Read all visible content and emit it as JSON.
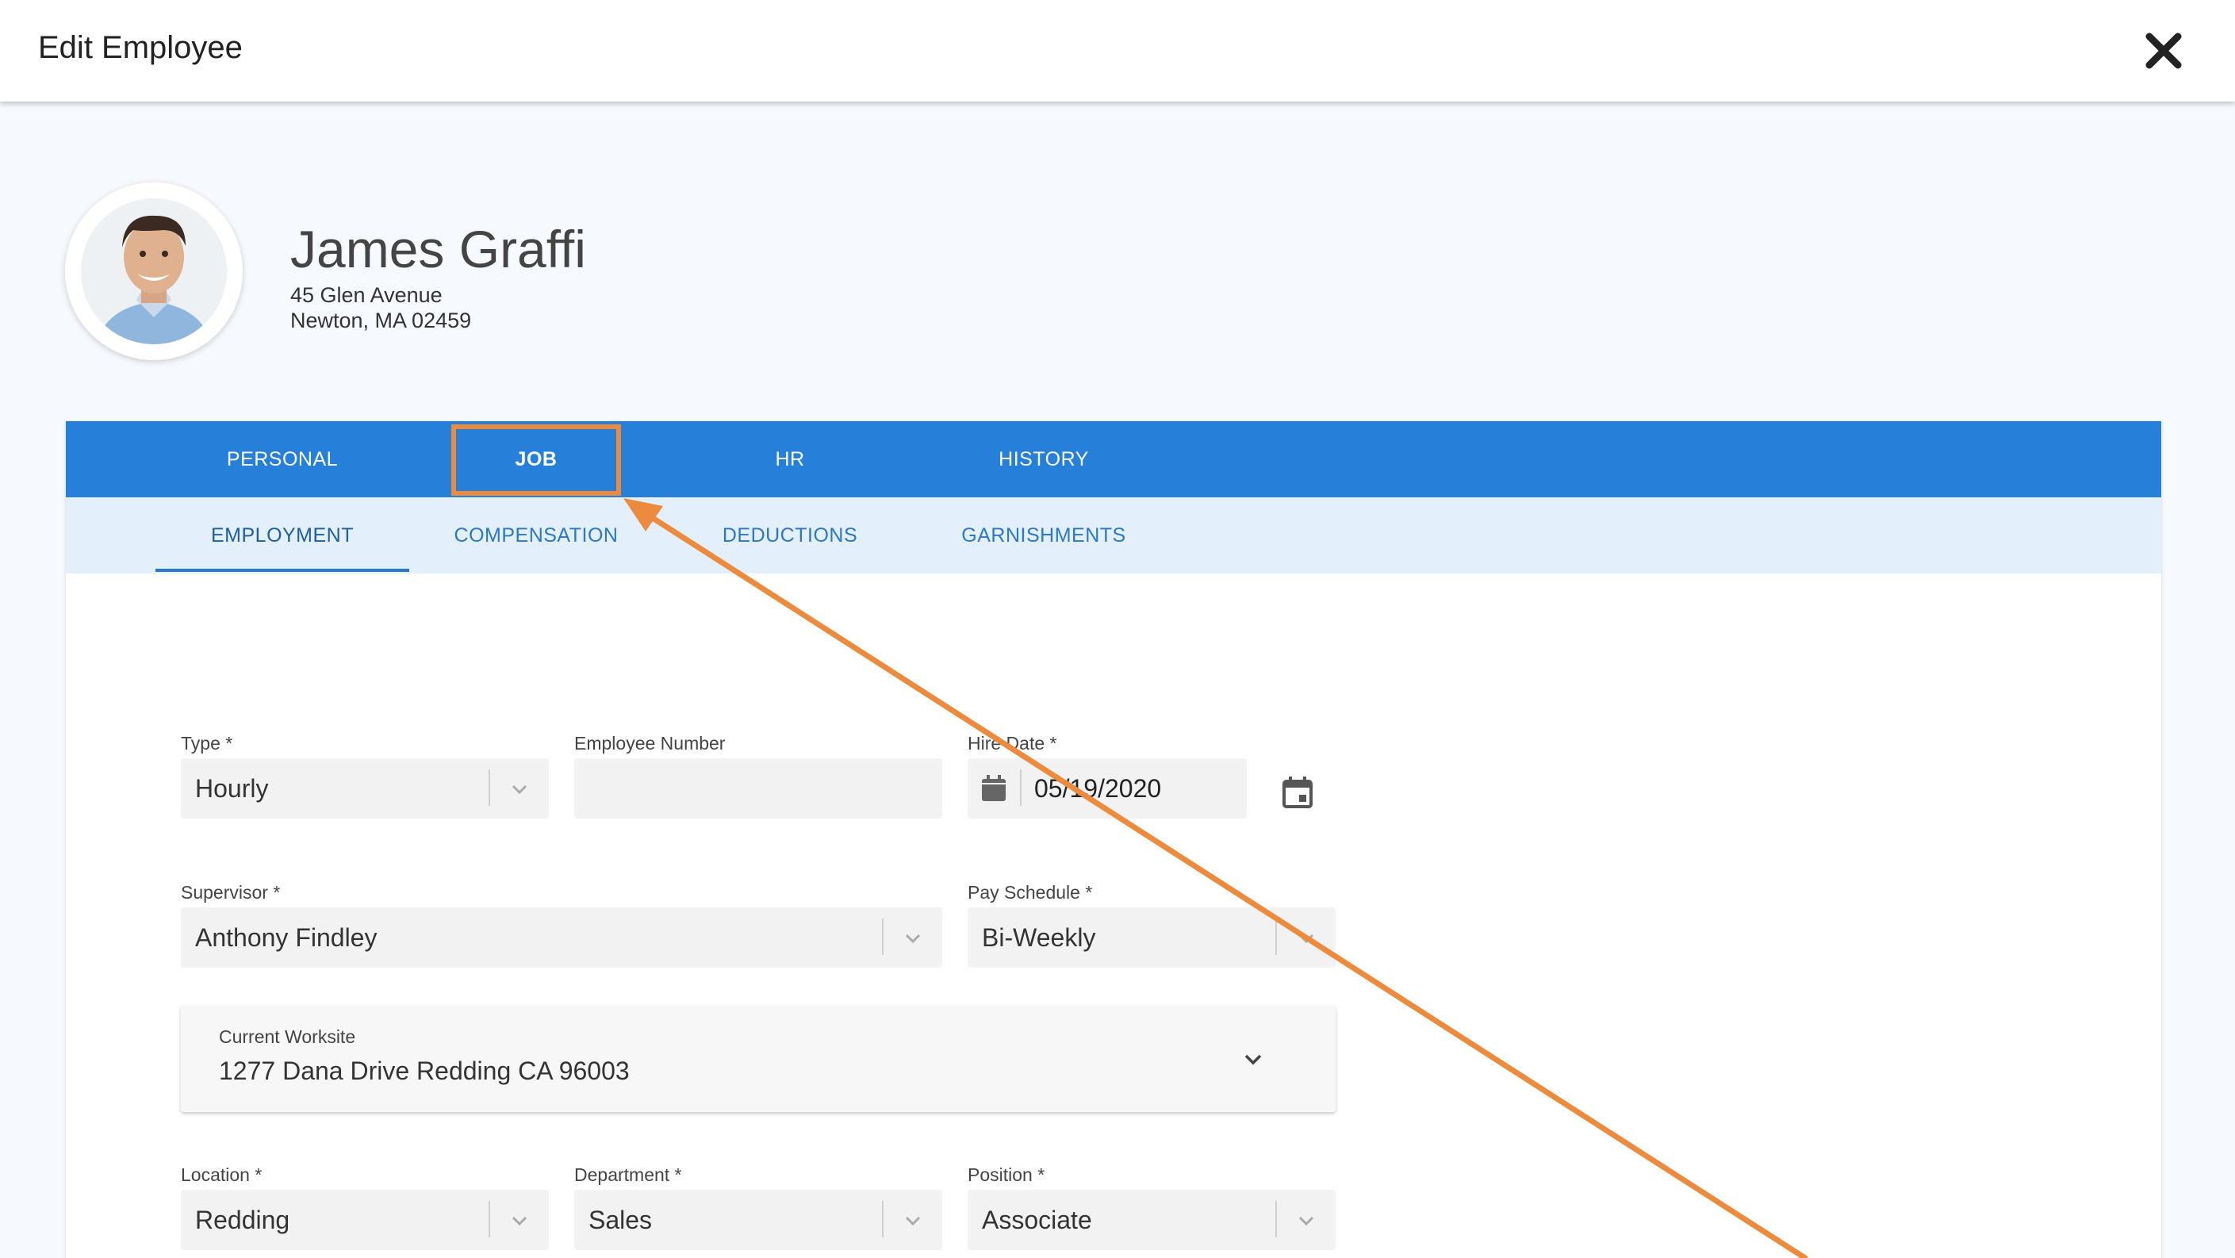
{
  "header": {
    "title": "Edit Employee",
    "close_icon": "close-icon"
  },
  "employee": {
    "name": "James Graffi",
    "address_line1": "45 Glen Avenue",
    "address_line2": "Newton, MA 02459"
  },
  "tabs": [
    {
      "label": "PERSONAL",
      "active": false
    },
    {
      "label": "JOB",
      "active": true
    },
    {
      "label": "HR",
      "active": false
    },
    {
      "label": "HISTORY",
      "active": false
    }
  ],
  "subtabs": [
    {
      "label": "EMPLOYMENT",
      "active": true
    },
    {
      "label": "COMPENSATION",
      "active": false
    },
    {
      "label": "DEDUCTIONS",
      "active": false
    },
    {
      "label": "GARNISHMENTS",
      "active": false
    }
  ],
  "form": {
    "type": {
      "label": "Type *",
      "value": "Hourly"
    },
    "employee_number": {
      "label": "Employee Number",
      "value": ""
    },
    "hire_date": {
      "label": "Hire Date *",
      "value": "05/19/2020"
    },
    "supervisor": {
      "label": "Supervisor *",
      "value": "Anthony Findley"
    },
    "pay_schedule": {
      "label": "Pay Schedule *",
      "value": "Bi-Weekly"
    },
    "current_worksite": {
      "label": "Current Worksite",
      "value": "1277 Dana Drive Redding CA 96003"
    },
    "location": {
      "label": "Location *",
      "value": "Redding"
    },
    "department": {
      "label": "Department *",
      "value": "Sales"
    },
    "position": {
      "label": "Position *",
      "value": "Associate"
    }
  },
  "colors": {
    "tab_bar": "#2680d9",
    "subtab_bar": "#e3effb",
    "highlight": "#ec8a3d",
    "field_bg": "#f2f2f2"
  }
}
